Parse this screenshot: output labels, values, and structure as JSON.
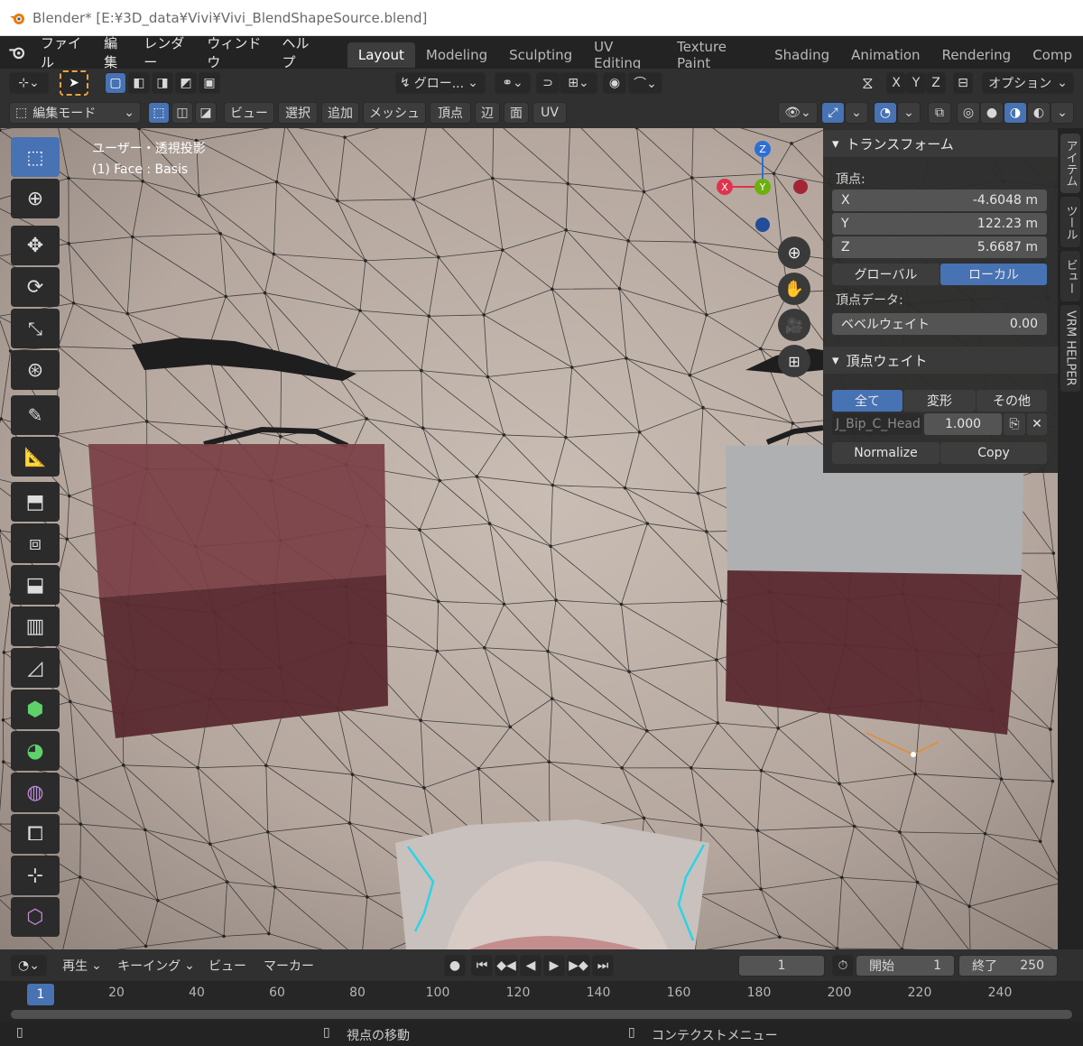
{
  "window": {
    "title": "Blender* [E:¥3D_data¥Vivi¥Vivi_BlendShapeSource.blend]"
  },
  "menu": [
    "ファイル",
    "編集",
    "レンダー",
    "ウィンドウ",
    "ヘルプ"
  ],
  "workspaces": [
    "Layout",
    "Modeling",
    "Sculpting",
    "UV Editing",
    "Texture Paint",
    "Shading",
    "Animation",
    "Rendering",
    "Comp"
  ],
  "active_workspace": "Layout",
  "header1": {
    "transform_orientation": "グロー...",
    "axes": [
      "X",
      "Y",
      "Z"
    ],
    "options": "オプション"
  },
  "header2": {
    "mode": "編集モード",
    "menus": [
      "ビュー",
      "選択",
      "追加",
      "メッシュ",
      "頂点",
      "辺",
      "面",
      "UV"
    ]
  },
  "viewport": {
    "view_label": "ユーザー・透視投影",
    "object_label": "(1) Face : Basis",
    "gizmo": {
      "x": "X",
      "y": "Y",
      "z": "Z"
    }
  },
  "npanel": {
    "transform": {
      "title": "トランスフォーム",
      "vertex_label": "頂点:",
      "fields": [
        {
          "name": "X",
          "value": "-4.6048 m"
        },
        {
          "name": "Y",
          "value": "122.23 m"
        },
        {
          "name": "Z",
          "value": "5.6687 m"
        }
      ],
      "space_global": "グローバル",
      "space_local": "ローカル",
      "vertex_data_label": "頂点データ:",
      "bevel_label": "ベベルウェイト",
      "bevel_value": "0.00"
    },
    "vertex_weights": {
      "title": "頂点ウェイト",
      "filters": [
        "全て",
        "変形",
        "その他"
      ],
      "group_name": "J_Bip_C_Head",
      "group_weight": "1.000",
      "normalize": "Normalize",
      "copy": "Copy"
    }
  },
  "side_tabs": [
    "アイテム",
    "ツール",
    "ビュー",
    "VRM HELPER"
  ],
  "timeline": {
    "menus": [
      "再生",
      "キーイング",
      "ビュー",
      "マーカー"
    ],
    "current_frame": "1",
    "start_label": "開始",
    "start": "1",
    "end_label": "終了",
    "end": "250",
    "ruler_current": "1",
    "ruler": [
      "20",
      "40",
      "60",
      "80",
      "100",
      "120",
      "140",
      "160",
      "180",
      "200",
      "220",
      "240"
    ]
  },
  "status": {
    "left": "視点の移動",
    "right": "コンテクストメニュー"
  },
  "colors": {
    "accent": "#4772b3",
    "bg": "#303030",
    "face": "#b8aca4",
    "select_edge": "#2ad4e6"
  }
}
